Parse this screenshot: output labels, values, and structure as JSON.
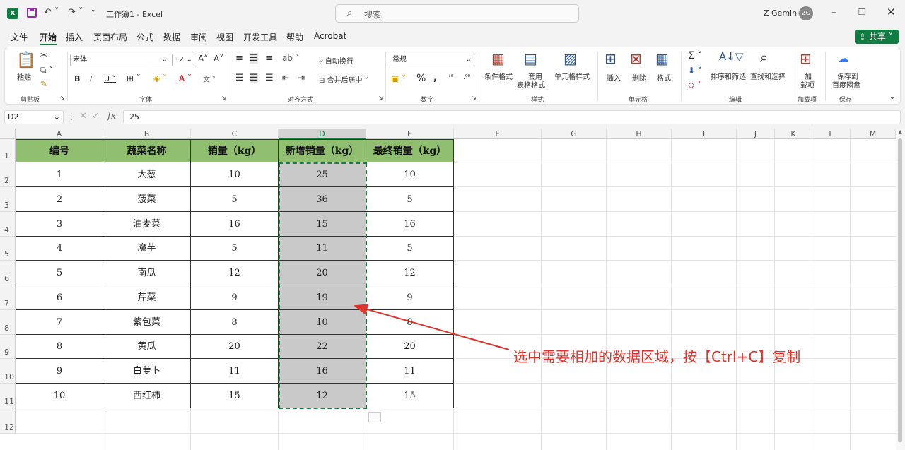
{
  "titlebar": {
    "doc_title": "工作簿1 - Excel",
    "search_placeholder": "搜索",
    "user_name": "Z Gemini",
    "avatar": "ZG"
  },
  "tabs": [
    "文件",
    "开始",
    "插入",
    "页面布局",
    "公式",
    "数据",
    "审阅",
    "视图",
    "开发工具",
    "帮助",
    "Acrobat"
  ],
  "share_label": "共享",
  "ribbon": {
    "paste": "粘贴",
    "font_name": "宋体",
    "font_size": "12",
    "wrap": "自动换行",
    "merge": "合并后居中",
    "number_format": "常规",
    "cond_format": "条件格式",
    "table_format_1": "套用",
    "table_format_2": "表格格式",
    "cell_style": "单元格样式",
    "insert": "插入",
    "delete": "删除",
    "format": "格式",
    "sort_filter": "排序和筛选",
    "find_select": "查找和选择",
    "addin_1": "加",
    "addin_2": "载项",
    "save_cloud_1": "保存到",
    "save_cloud_2": "百度网盘",
    "groups": [
      "剪贴板",
      "字体",
      "对齐方式",
      "数字",
      "样式",
      "单元格",
      "编辑",
      "加载项",
      "保存"
    ]
  },
  "formula": {
    "name_box": "D2",
    "fx": "fx",
    "value": "25"
  },
  "columns": [
    "A",
    "B",
    "C",
    "D",
    "E",
    "F",
    "G",
    "H",
    "I",
    "J",
    "K",
    "L",
    "M"
  ],
  "rows": [
    "1",
    "2",
    "3",
    "4",
    "5",
    "6",
    "7",
    "8",
    "9",
    "10",
    "11",
    "12"
  ],
  "table": {
    "headers": [
      "编号",
      "蔬菜名称",
      "销量（kg）",
      "新增销量（kg）",
      "最终销量（kg）"
    ],
    "data": [
      [
        "1",
        "大葱",
        "10",
        "25",
        "10"
      ],
      [
        "2",
        "菠菜",
        "5",
        "36",
        "5"
      ],
      [
        "3",
        "油麦菜",
        "16",
        "15",
        "16"
      ],
      [
        "4",
        "魔芋",
        "5",
        "11",
        "5"
      ],
      [
        "5",
        "南瓜",
        "12",
        "20",
        "12"
      ],
      [
        "6",
        "芹菜",
        "9",
        "19",
        "9"
      ],
      [
        "7",
        "紫包菜",
        "8",
        "10",
        "8"
      ],
      [
        "8",
        "黄瓜",
        "20",
        "22",
        "20"
      ],
      [
        "9",
        "白萝卜",
        "11",
        "16",
        "11"
      ],
      [
        "10",
        "西红柿",
        "15",
        "12",
        "15"
      ]
    ]
  },
  "annotation": "选中需要相加的数据区域，按【Ctrl+C】复制",
  "colors": {
    "accent": "#107c41",
    "header_fill": "#8fbf6f",
    "selected_fill": "#c9c9c9",
    "note": "#e0312a"
  }
}
